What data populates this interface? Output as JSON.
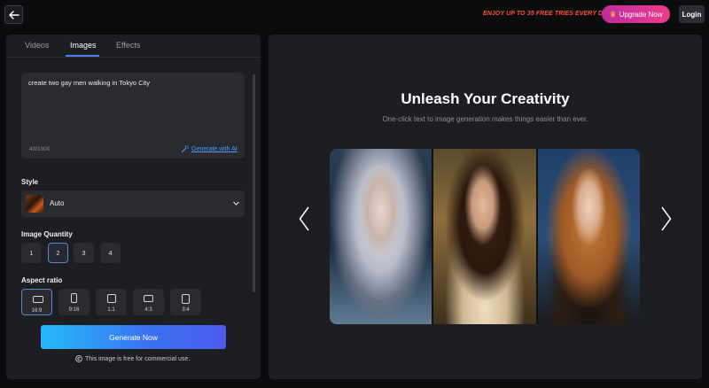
{
  "topbar": {
    "promo": "ENJOY UP TO 35 FREE TRIES EVERY DAY!",
    "upgrade_label": "Upgrade Now",
    "login_label": "Login"
  },
  "tabs": [
    {
      "label": "Videos",
      "active": false
    },
    {
      "label": "Images",
      "active": true
    },
    {
      "label": "Effects",
      "active": false
    }
  ],
  "prompt": {
    "value": "create two gay men walking in Tokyo City",
    "counter": "40/1000",
    "generate_ai_label": "Generate with AI"
  },
  "style": {
    "label": "Style",
    "selected": "Auto"
  },
  "quantity": {
    "label": "Image Quantity",
    "options": [
      "1",
      "2",
      "3",
      "4"
    ],
    "selected": "2"
  },
  "aspect": {
    "label": "Aspect ratio",
    "options": [
      "16:9",
      "9:16",
      "1:1",
      "4:3",
      "3:4"
    ],
    "selected": "16:9"
  },
  "generate_label": "Generate Now",
  "free_note": "This image is free for commercial use.",
  "hero": {
    "title": "Unleash Your Creativity",
    "subtitle": "One-click text to image generation makes things easier than ever."
  },
  "colors": {
    "accent": "#4e7cff",
    "promo": "#ff4d2e",
    "upgrade": "#e0338f",
    "generate_start": "#25b9f5",
    "generate_end": "#4b5bee"
  },
  "icons": {
    "back": "arrow-left-icon",
    "crown": "crown-icon",
    "chevron": "chevron-down-icon",
    "magic": "magic-wand-icon",
    "copyright": "copyright-icon",
    "prev": "chevron-left-icon",
    "next": "chevron-right-icon"
  }
}
